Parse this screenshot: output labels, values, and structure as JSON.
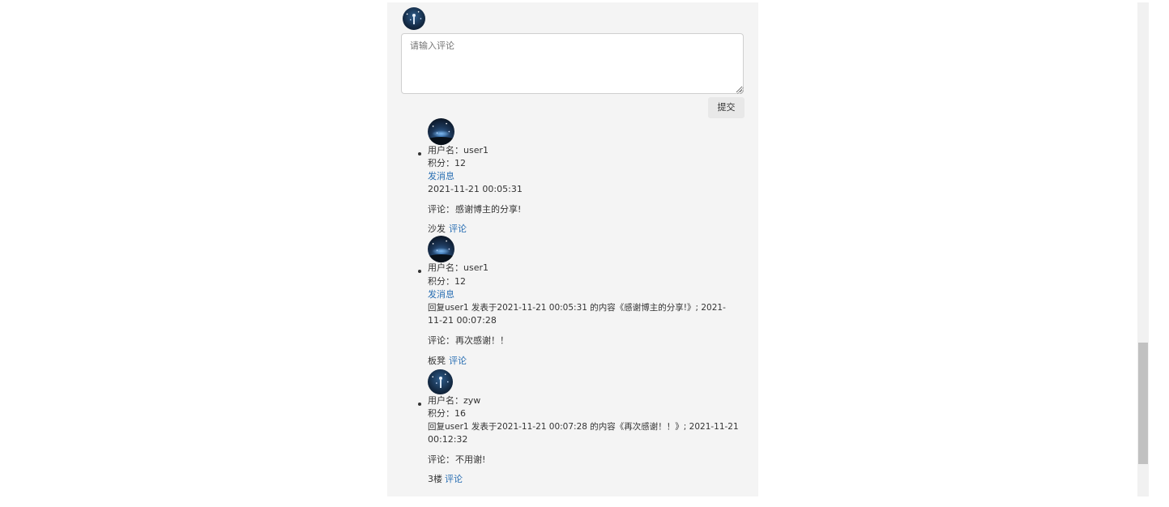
{
  "composer": {
    "placeholder": "请输入评论",
    "submit_label": "提交"
  },
  "comments": [
    {
      "username_label": "用户名：user1",
      "points_label": "积分：12",
      "message_link": "发消息",
      "meta_line1": "2021-11-21 00:05:31",
      "meta_line2": "",
      "comment_label": "评论：",
      "comment_text": "感谢博主的分享!",
      "floor": "沙发",
      "reply_link": "评论"
    },
    {
      "username_label": "用户名：user1",
      "points_label": "积分：12",
      "message_link": "发消息",
      "meta_line1": "回复user1 发表于2021-11-21 00:05:31 的内容《感谢博主的分享!》; 2021-",
      "meta_line2": "11-21 00:07:28",
      "comment_label": "评论：",
      "comment_text": "再次感谢！！",
      "floor": "板凳",
      "reply_link": "评论"
    },
    {
      "username_label": "用户名：zyw",
      "points_label": "积分：16",
      "meta_line1": "回复user1 发表于2021-11-21 00:07:28 的内容《再次感谢！！》; 2021-11-21",
      "meta_line2": "00:12:32",
      "comment_label": "评论：",
      "comment_text": "不用谢!",
      "floor": "3楼",
      "reply_link": "评论"
    }
  ]
}
